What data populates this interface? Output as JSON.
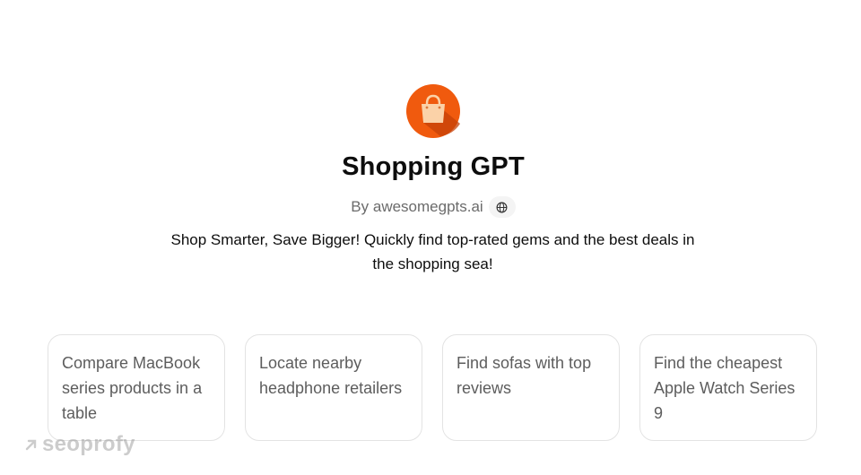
{
  "gpt": {
    "title": "Shopping GPT",
    "byline": "By awesomegpts.ai",
    "description": "Shop Smarter, Save Bigger! Quickly find top-rated gems and the best deals in the shopping sea!"
  },
  "icons": {
    "logo": "shopping-bag-icon",
    "website": "globe-icon",
    "watermark": "arrow-up-right-icon"
  },
  "colors": {
    "logo_background": "#f05a0e",
    "logo_shadow": "#c64208",
    "bag": "#fbd2a8"
  },
  "starters": [
    {
      "text": "Compare MacBook series products in a table"
    },
    {
      "text": "Locate nearby headphone retailers"
    },
    {
      "text": "Find sofas with top reviews"
    },
    {
      "text": "Find the cheapest Apple Watch Series 9"
    }
  ],
  "watermark": {
    "text": "seoprofy"
  }
}
